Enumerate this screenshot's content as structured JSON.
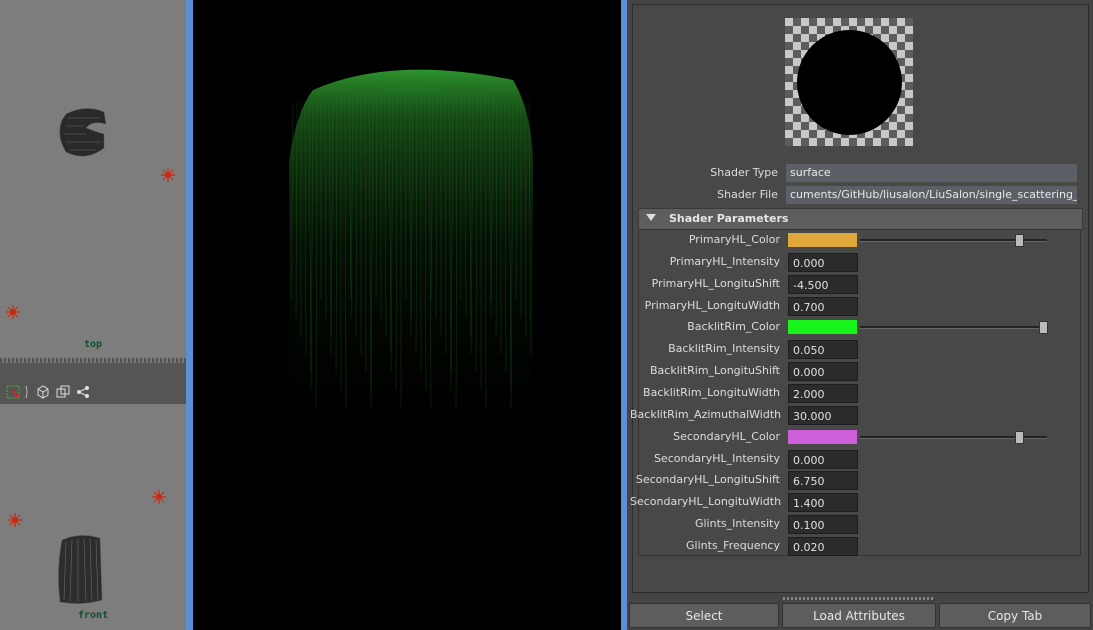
{
  "viewports": {
    "top_label": "top",
    "front_label": "front"
  },
  "shader": {
    "type_label": "Shader Type",
    "type_value": "surface",
    "file_label": "Shader File",
    "file_value": "cuments/GitHub/liusalon/LiuSalon/single_scattering_AFC.sdl"
  },
  "section": {
    "title": "Shader Parameters"
  },
  "params": [
    {
      "label": "PrimaryHL_Color",
      "kind": "color",
      "color": "#e0a83a",
      "slider_value": 0.85
    },
    {
      "label": "PrimaryHL_Intensity",
      "kind": "number",
      "value": "0.000"
    },
    {
      "label": "PrimaryHL_LongituShift",
      "kind": "number",
      "value": "-4.500"
    },
    {
      "label": "PrimaryHL_LongituWidth",
      "kind": "number",
      "value": "0.700"
    },
    {
      "label": "BacklitRim_Color",
      "kind": "color",
      "color": "#16f51a",
      "slider_value": 0.98
    },
    {
      "label": "BacklitRim_Intensity",
      "kind": "number",
      "value": "0.050"
    },
    {
      "label": "BacklitRim_LongituShift",
      "kind": "number",
      "value": "0.000"
    },
    {
      "label": "BacklitRim_LongituWidth",
      "kind": "number",
      "value": "2.000"
    },
    {
      "label": "BacklitRim_AzimuthalWidth",
      "kind": "number",
      "value": "30.000"
    },
    {
      "label": "SecondaryHL_Color",
      "kind": "color",
      "color": "#cf5fd8",
      "slider_value": 0.85
    },
    {
      "label": "SecondaryHL_Intensity",
      "kind": "number",
      "value": "0.000"
    },
    {
      "label": "SecondaryHL_LongituShift",
      "kind": "number",
      "value": "6.750"
    },
    {
      "label": "SecondaryHL_LongituWidth",
      "kind": "number",
      "value": "1.400"
    },
    {
      "label": "Glints_Intensity",
      "kind": "number",
      "value": "0.100"
    },
    {
      "label": "Glints_Frequency",
      "kind": "number",
      "value": "0.020"
    }
  ],
  "buttons": {
    "select": "Select",
    "load_attributes": "Load Attributes",
    "copy_tab": "Copy Tab"
  },
  "colors": {
    "viewport_bg": "#7d7d7d",
    "panel_separator": "#5b8fd6",
    "render_bg": "#000000",
    "hair_highlight": "#1e7a1e",
    "light_icon": "#cc2a10"
  }
}
